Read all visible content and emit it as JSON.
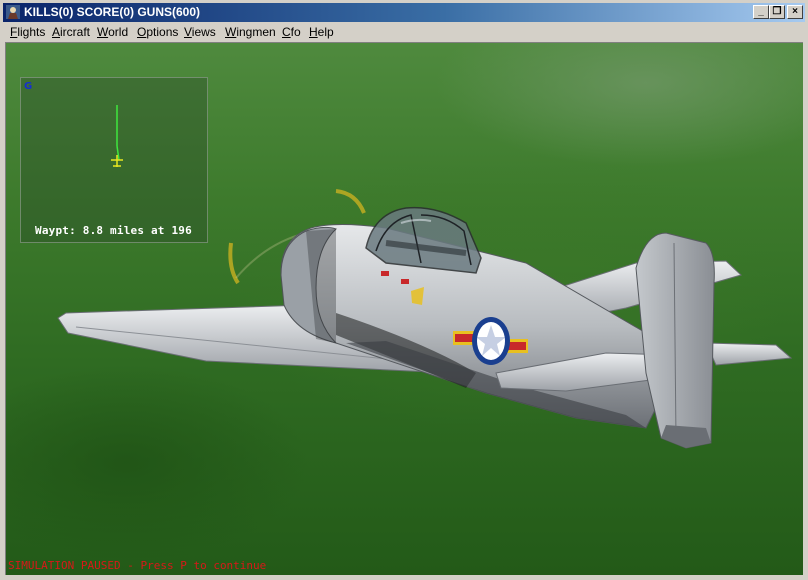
{
  "window": {
    "title": "KILLS(0) SCORE(0) GUNS(600)",
    "controls": {
      "minimize": "_",
      "restore": "❐",
      "close": "×"
    }
  },
  "menu": {
    "items": [
      "Flights",
      "Aircraft",
      "World",
      "Options",
      "Views",
      "Wingmen",
      "Cfo",
      "Help"
    ]
  },
  "hud": {
    "map_marker": "G",
    "waypoint_text": "Waypt: 8.8 miles at 196",
    "track_color": "#3ee63e",
    "player_color": "#e8e820"
  },
  "status": {
    "paused_text": "SIMULATION PAUSED",
    "separator": " - ",
    "hint_text": "Press P to continue"
  },
  "aircraft": {
    "roundel_colors": {
      "ring": "#1a3f8f",
      "star": "#ffffff",
      "bar_red": "#c8282a",
      "bar_yellow": "#e8c020"
    }
  }
}
